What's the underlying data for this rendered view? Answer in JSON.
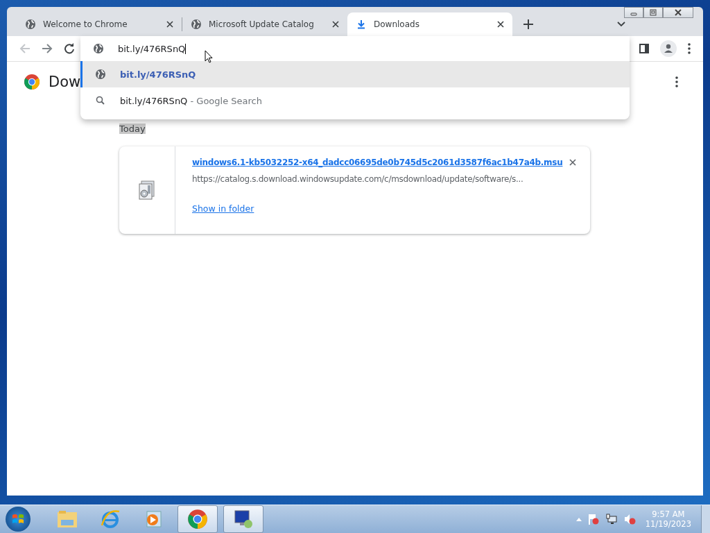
{
  "tabs": [
    {
      "title": "Welcome to Chrome",
      "kind": "webpage",
      "selected": false
    },
    {
      "title": "Microsoft Update Catalog",
      "kind": "webpage",
      "selected": false
    },
    {
      "title": "Downloads",
      "kind": "downloads",
      "selected": true
    }
  ],
  "nav": {
    "back_disabled": true,
    "forward_disabled": false
  },
  "omnibox": {
    "value": "bit.ly/476RSnQ"
  },
  "suggestions": [
    {
      "kind": "url",
      "text": "bit.ly/476RSnQ",
      "selected": true
    },
    {
      "kind": "search",
      "text": "bit.ly/476RSnQ",
      "suffix": " - Google Search",
      "selected": false
    }
  ],
  "page": {
    "heading": "Dow",
    "date_label": "Today",
    "downloads": [
      {
        "filename": "windows6.1-kb5032252-x64_dadcc06695de0b745d5c2061d3587f6ac1b47a4b.msu",
        "url": "https://catalog.s.download.windowsupdate.com/c/msdownload/update/software/s...",
        "action": "Show in folder"
      }
    ]
  },
  "taskbar": {
    "apps": [
      {
        "kind": "folder",
        "running": false
      },
      {
        "kind": "ie",
        "running": false
      },
      {
        "kind": "media",
        "running": false
      },
      {
        "kind": "chrome",
        "running": true
      },
      {
        "kind": "remote",
        "running": true
      }
    ],
    "clock": {
      "time": "9:57 AM",
      "date": "11/19/2023"
    }
  }
}
